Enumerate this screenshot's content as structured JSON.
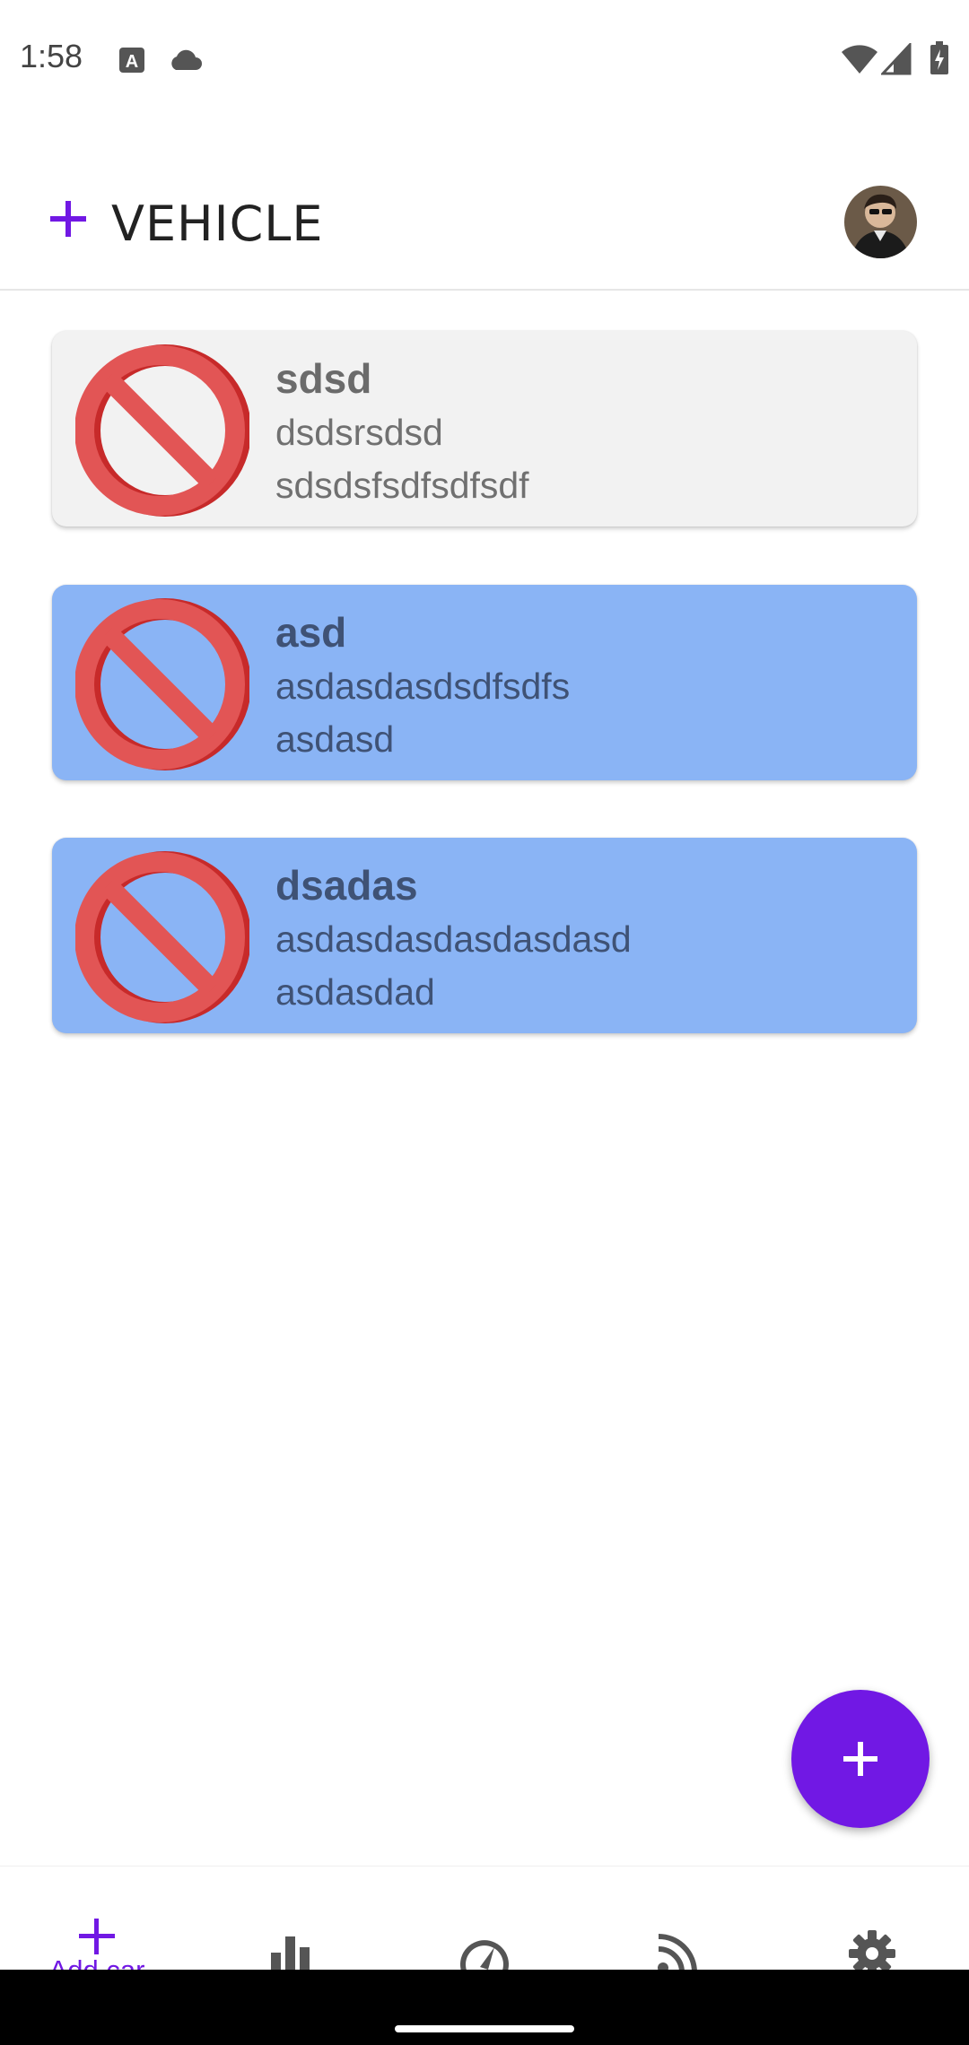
{
  "status_bar": {
    "time": "1:58"
  },
  "app_bar": {
    "title": "VEHICLE",
    "accent_color": "#7118e4"
  },
  "vehicles": [
    {
      "name": "sdsd",
      "line1": "dsdsrsdsd",
      "line2": "sdsdsfsdfsdfsdf",
      "state": "default",
      "bg": "#f2f2f2"
    },
    {
      "name": "asd",
      "line1": "asdasdasdsdfsdfs",
      "line2": "asdasd",
      "state": "selected",
      "bg": "#8ab4f5"
    },
    {
      "name": "dsadas",
      "line1": "asdasdasdasdasdasd",
      "line2": "asdasdad",
      "state": "selected",
      "bg": "#8ab4f5"
    }
  ],
  "fab": {
    "icon": "plus-icon"
  },
  "bottom_nav": {
    "items": [
      {
        "label": "Add car",
        "icon": "plus-icon",
        "active": true
      },
      {
        "label": "",
        "icon": "bar-chart-icon",
        "active": false
      },
      {
        "label": "",
        "icon": "speedometer-icon",
        "active": false
      },
      {
        "label": "",
        "icon": "rss-feed-icon",
        "active": false
      },
      {
        "label": "",
        "icon": "gear-icon",
        "active": false
      }
    ]
  }
}
